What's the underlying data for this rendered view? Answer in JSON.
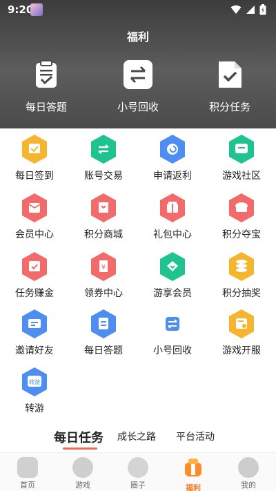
{
  "status": {
    "time": "9:20"
  },
  "header": {
    "title": "福利"
  },
  "top_actions": [
    {
      "label": "每日答题",
      "icon": "quiz-clipboard-icon"
    },
    {
      "label": "小号回收",
      "icon": "swap-arrows-icon"
    },
    {
      "label": "积分任务",
      "icon": "document-check-icon"
    }
  ],
  "grid": [
    {
      "label": "每日签到",
      "icon": "calendar-check-icon",
      "color": "#f5b52e"
    },
    {
      "label": "账号交易",
      "icon": "exchange-icon",
      "color": "#1fc38e"
    },
    {
      "label": "申请返利",
      "icon": "refund-icon",
      "color": "#4d8ef0"
    },
    {
      "label": "游戏社区",
      "icon": "chat-bubble-icon",
      "color": "#1fc38e"
    },
    {
      "label": "会员中心",
      "icon": "vip-card-icon",
      "color": "#f26a6a"
    },
    {
      "label": "积分商城",
      "icon": "points-mall-icon",
      "color": "#f26a6a"
    },
    {
      "label": "礼包中心",
      "icon": "gift-pack-icon",
      "color": "#f26a6a"
    },
    {
      "label": "积分夺宝",
      "icon": "treasure-icon",
      "color": "#f26a6a"
    },
    {
      "label": "任务赚金",
      "icon": "task-clipboard-icon",
      "color": "#f26a6a"
    },
    {
      "label": "领券中心",
      "icon": "coupon-icon",
      "color": "#f26a6a"
    },
    {
      "label": "游享会员",
      "icon": "diamond-heart-icon",
      "color": "#1fc38e"
    },
    {
      "label": "积分抽奖",
      "icon": "coin-stack-icon",
      "color": "#f5b52e"
    },
    {
      "label": "邀请好友",
      "icon": "invite-mail-icon",
      "color": "#4d8ef0"
    },
    {
      "label": "每日答题",
      "icon": "quiz-sheet-icon",
      "color": "#4d8ef0"
    },
    {
      "label": "小号回收",
      "icon": "swap-arrows-icon",
      "color": "#4d8ef0"
    },
    {
      "label": "游戏开服",
      "icon": "server-open-icon",
      "color": "#f5b52e"
    },
    {
      "label": "转游",
      "icon": "transfer-game-icon",
      "color": "#4d8ef0",
      "badge": "转游"
    }
  ],
  "tabs": [
    {
      "label": "每日任务",
      "active": true
    },
    {
      "label": "成长之路",
      "active": false
    },
    {
      "label": "平台活动",
      "active": false
    }
  ],
  "bottom_nav": [
    {
      "label": "首页",
      "icon": "gamepad-icon",
      "active": false
    },
    {
      "label": "游戏",
      "icon": "heart-icon",
      "active": false
    },
    {
      "label": "圈子",
      "icon": "circle-icon",
      "active": false
    },
    {
      "label": "福利",
      "icon": "gift-icon",
      "active": true
    },
    {
      "label": "我的",
      "icon": "profile-icon",
      "active": false
    }
  ],
  "colors": {
    "accent": "#ff7a1a",
    "tab_underline": "#f06a56",
    "header_dark": "#3c3c3c"
  }
}
